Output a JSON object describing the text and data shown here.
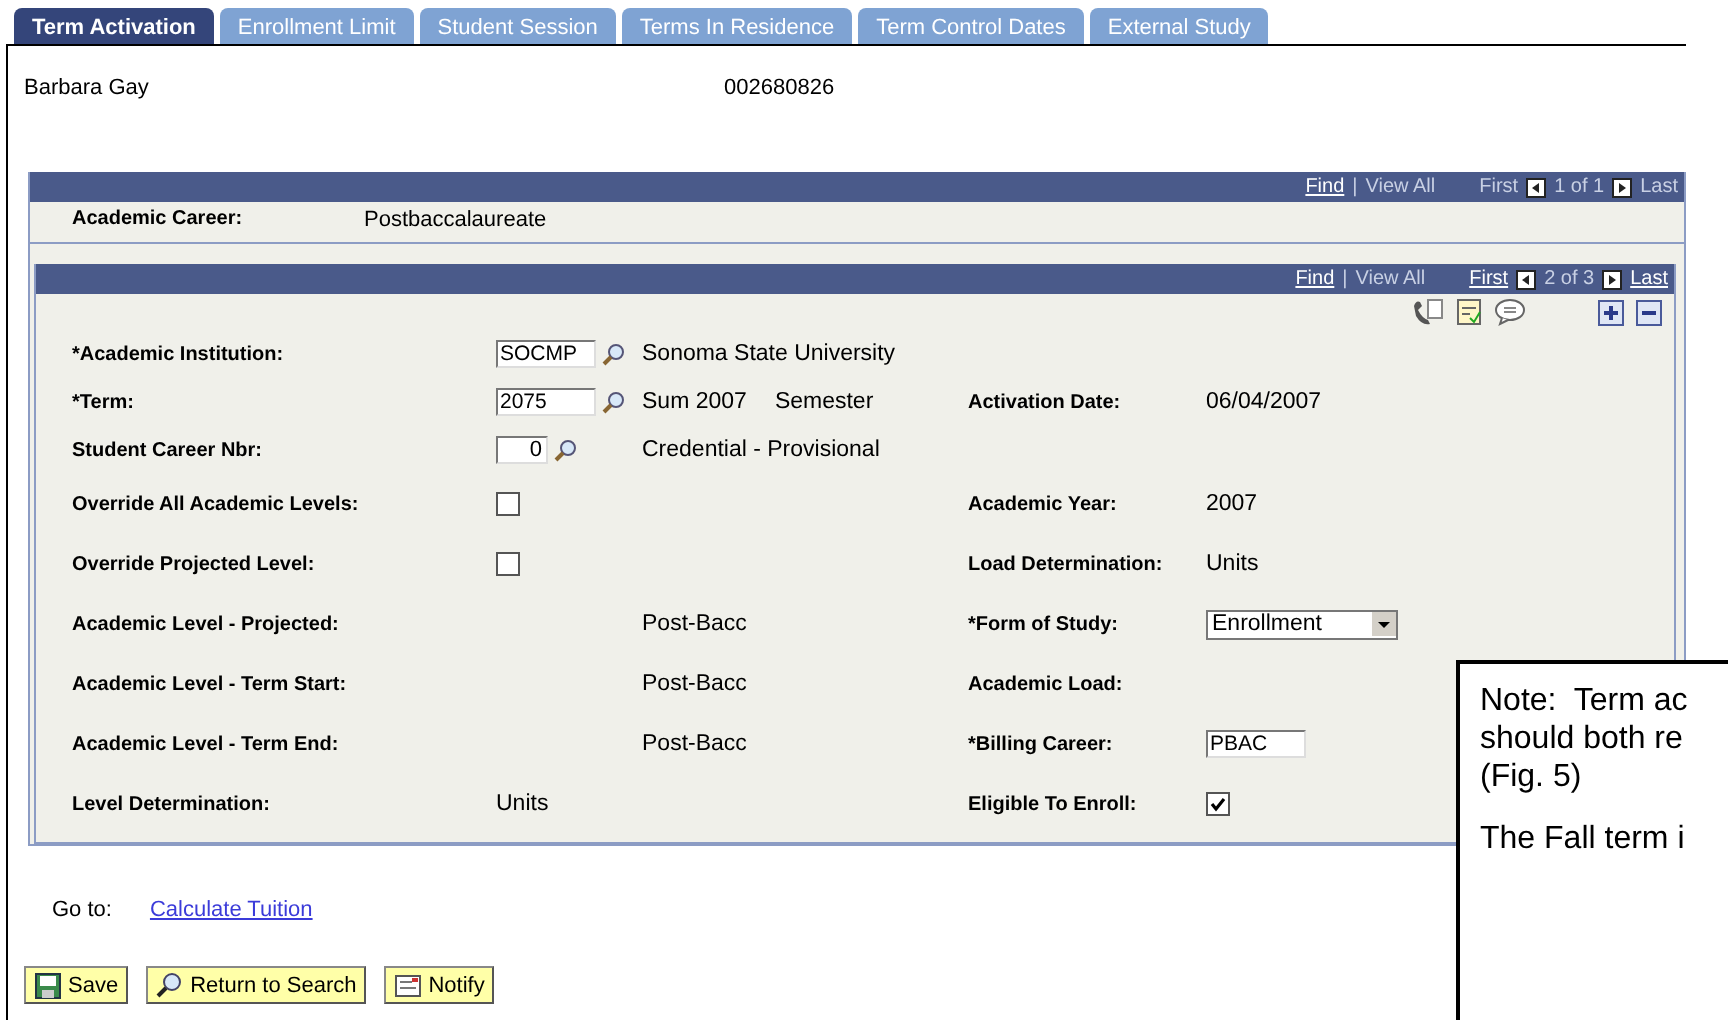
{
  "tabs": [
    {
      "label": "Term Activation",
      "selected": true
    },
    {
      "label": "Enrollment Limit",
      "selected": false
    },
    {
      "label": "Student Session",
      "selected": false
    },
    {
      "label": "Terms In Residence",
      "selected": false
    },
    {
      "label": "Term Control Dates",
      "selected": false
    },
    {
      "label": "External Study",
      "selected": false
    }
  ],
  "student": {
    "name": "Barbara Gay",
    "id": "002680826"
  },
  "career_nav": {
    "find": "Find",
    "separator": "|",
    "view_all": "View All",
    "first": {
      "label": "First",
      "enabled": false
    },
    "count": "1 of 1",
    "last": {
      "label": "Last",
      "enabled": false
    }
  },
  "career": {
    "label": "Academic Career:",
    "value": "Postbaccalaureate"
  },
  "term_nav": {
    "find": "Find",
    "separator": "|",
    "view_all": "View All",
    "first": {
      "label": "First",
      "enabled": true
    },
    "count": "2 of 3",
    "last": {
      "label": "Last",
      "enabled": true
    }
  },
  "rows": [
    {
      "left": {
        "kind": "lookup",
        "label": "*Academic Institution:",
        "value": "SOCMP",
        "descriptions": [
          "Sonoma State University"
        ]
      }
    },
    {
      "left": {
        "kind": "lookup",
        "label": "*Term:",
        "value": "2075",
        "descriptions": [
          "Sum 2007",
          "Semester"
        ]
      },
      "right": {
        "kind": "value",
        "label": "Activation Date:",
        "value": "06/04/2007"
      }
    },
    {
      "left": {
        "kind": "lookup",
        "label": "Student Career Nbr:",
        "value": "0",
        "descriptions": [
          "Credential - Provisional"
        ]
      }
    },
    {
      "left": {
        "kind": "checkbox",
        "label": "Override All Academic Levels:",
        "checked": false
      },
      "right": {
        "kind": "value",
        "label": "Academic Year:",
        "value": "2007"
      }
    },
    {
      "left": {
        "kind": "checkbox",
        "label": "Override Projected Level:",
        "checked": false
      },
      "right": {
        "kind": "value",
        "label": "Load Determination:",
        "value": "Units"
      }
    },
    {
      "left": {
        "kind": "description",
        "label": "Academic Level - Projected:",
        "descriptions": [
          "Post-Bacc"
        ]
      },
      "right": {
        "kind": "select",
        "label": "*Form of Study:",
        "value": "Enrollment"
      }
    },
    {
      "left": {
        "kind": "description",
        "label": "Academic Level - Term Start:",
        "descriptions": [
          "Post-Bacc"
        ]
      },
      "right": {
        "kind": "label_only",
        "label": "Academic Load:"
      }
    },
    {
      "left": {
        "kind": "description",
        "label": "Academic Level - Term End:",
        "descriptions": [
          "Post-Bacc"
        ]
      },
      "right": {
        "kind": "field",
        "label": "*Billing Career:",
        "value": "PBAC"
      }
    },
    {
      "left": {
        "kind": "value",
        "label": "Level Determination:",
        "value": "Units"
      },
      "right": {
        "kind": "checkbox",
        "label": "Eligible To Enroll:",
        "checked": true
      }
    }
  ],
  "goto": {
    "label": "Go to:",
    "link": "Calculate Tuition"
  },
  "buttons": [
    {
      "kind": "save",
      "label": "Save"
    },
    {
      "kind": "search",
      "label": "Return to Search"
    },
    {
      "kind": "notify",
      "label": "Notify"
    }
  ],
  "note": {
    "lines": [
      "Note:  Term ac",
      "should both re",
      "(Fig. 5)",
      "The Fall term i"
    ]
  }
}
